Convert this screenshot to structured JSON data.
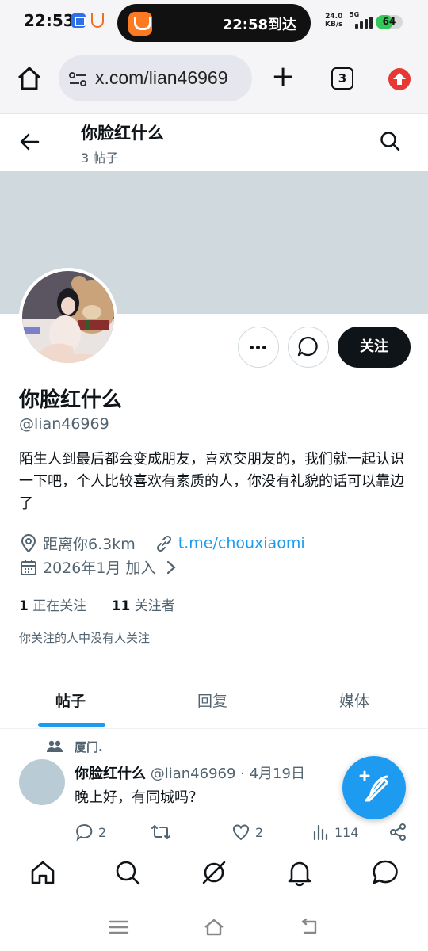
{
  "status_bar": {
    "time": "22:53",
    "pill_text": "22:58到达",
    "net_speed_value": "24.0",
    "net_speed_unit": "KB/s",
    "network": "5G",
    "battery": "64",
    "battery_level": 0.64
  },
  "browser": {
    "url": "x.com/lian46969",
    "tab_count": "3"
  },
  "header": {
    "name": "你脸红什么",
    "post_count": "3 帖子"
  },
  "profile": {
    "follow_label": "关注",
    "name": "你脸红什么",
    "handle": "@lian46969",
    "bio": "陌生人到最后都会变成朋友，喜欢交朋友的，我们就一起认识一下吧，个人比较喜欢有素质的人，你没有礼貌的话可以靠边了",
    "location": "距离你6.3km",
    "link": "t.me/chouxiaomi",
    "joined": "2026年1月 加入",
    "following_count": "1",
    "following_label": "正在关注",
    "followers_count": "11",
    "followers_label": "关注者",
    "mutual_note": "你关注的人中没有人关注"
  },
  "tabs": [
    {
      "label": "帖子"
    },
    {
      "label": "回复"
    },
    {
      "label": "媒体"
    }
  ],
  "post": {
    "context": "厦门.",
    "author_name": "你脸红什么",
    "author_meta": "@lian46969 · 4月19日",
    "text": "晚上好，有同城吗？",
    "replies": "2",
    "likes": "2",
    "views": "114"
  },
  "icons": {
    "bottom_nav": [
      "home-icon",
      "search-icon",
      "grok-icon",
      "notifications-icon",
      "messages-icon"
    ]
  },
  "colors": {
    "accent": "#1d9bf0",
    "banner": "#cfd9de",
    "text_primary": "#0f1419",
    "text_secondary": "#536471"
  }
}
